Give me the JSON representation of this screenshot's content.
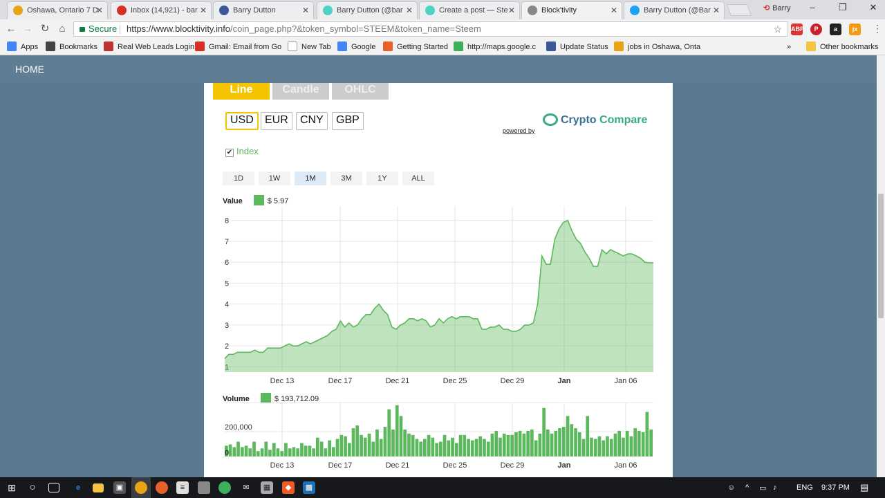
{
  "browser": {
    "tabs": [
      {
        "title": "Oshawa, Ontario 7 D",
        "icon": "weather-icon",
        "color": "#e8a317"
      },
      {
        "title": "Inbox (14,921) - bar",
        "icon": "gmail-icon",
        "color": "#d93025"
      },
      {
        "title": "Barry Dutton",
        "icon": "facebook-icon",
        "color": "#3b5998"
      },
      {
        "title": "Barry Dutton (@bar",
        "icon": "steemit-icon",
        "color": "#4fd1c5"
      },
      {
        "title": "Create a post — Ste",
        "icon": "steemit-icon",
        "color": "#4fd1c5"
      },
      {
        "title": "Block'tivity",
        "icon": "loading-icon",
        "color": "#888888"
      },
      {
        "title": "Barry Dutton (@Bar",
        "icon": "twitter-icon",
        "color": "#1da1f2"
      }
    ],
    "active_tab": 5,
    "profile_name": "Barry",
    "secure_label": "Secure",
    "url_host": "https://www.blocktivity.info",
    "url_path": "/coin_page.php?&token_symbol=STEEM&token_name=Steem",
    "bookmarks": [
      {
        "label": "Apps",
        "icon": "apps-icon"
      },
      {
        "label": "Bookmarks",
        "icon": "star-icon"
      },
      {
        "label": "Real Web Leads Login",
        "icon": "realweb-icon"
      },
      {
        "label": "Gmail: Email from Go",
        "icon": "gmail-icon"
      },
      {
        "label": "New Tab",
        "icon": "page-icon"
      },
      {
        "label": "Google",
        "icon": "google-icon"
      },
      {
        "label": "Getting Started",
        "icon": "firefox-icon"
      },
      {
        "label": "http://maps.google.c",
        "icon": "maps-icon"
      },
      {
        "label": "Update Status",
        "icon": "facebook-icon"
      },
      {
        "label": "jobs in Oshawa, Onta",
        "icon": "jobs-icon"
      }
    ],
    "bookmarks_more": "»",
    "other_bookmarks": "Other bookmarks"
  },
  "page": {
    "nav_home": "HOME",
    "chart_tabs": [
      {
        "label": "Line",
        "color": "#f5c400"
      },
      {
        "label": "Candle",
        "color": "#cccccc"
      },
      {
        "label": "OHLC",
        "color": "#cccccc"
      }
    ],
    "currencies": [
      "USD",
      "EUR",
      "CNY",
      "GBP"
    ],
    "selected_currency": "USD",
    "powered_by": "powered by",
    "logo_part1": "Crypto",
    "logo_part2": "Compare",
    "index_label": "Index",
    "index_checked": "✔",
    "ranges": [
      "1D",
      "1W",
      "1M",
      "3M",
      "1Y",
      "ALL"
    ],
    "selected_range": "1M",
    "value_label": "Value",
    "value_text": "$ 5.97",
    "volume_label": "Volume",
    "volume_text": "$ 193,712.09"
  },
  "chart_data": [
    {
      "type": "area",
      "title": "Value",
      "ylim": [
        1,
        8
      ],
      "yticks": [
        1,
        2,
        3,
        4,
        5,
        6,
        7,
        8
      ],
      "xlabels": [
        "Dec 13",
        "Dec 17",
        "Dec 21",
        "Dec 25",
        "Dec 29",
        "Jan",
        "Jan 06"
      ],
      "x": [
        0,
        1,
        2,
        3,
        4,
        5,
        6,
        7,
        8,
        9,
        10,
        11,
        12,
        13,
        14,
        15,
        16,
        17,
        18,
        19,
        20,
        21,
        22,
        23,
        24,
        25,
        26,
        27,
        28,
        29,
        30,
        31,
        32,
        33,
        34,
        35,
        36,
        37,
        38,
        39,
        40,
        41,
        42,
        43,
        44,
        45,
        46,
        47,
        48,
        49,
        50,
        51,
        52,
        53,
        54,
        55,
        56,
        57,
        58,
        59,
        60,
        61,
        62,
        63,
        64,
        65,
        66,
        67,
        68,
        69,
        70,
        71,
        72,
        73,
        74,
        75,
        76,
        77,
        78,
        79,
        80,
        81,
        82,
        83,
        84,
        85,
        86,
        87,
        88,
        89,
        90,
        91,
        92,
        93,
        94,
        95,
        96,
        97,
        98,
        99,
        100
      ],
      "values": [
        1.4,
        1.6,
        1.6,
        1.7,
        1.7,
        1.7,
        1.7,
        1.8,
        1.7,
        1.7,
        1.9,
        1.9,
        1.9,
        1.9,
        2.0,
        2.1,
        2.0,
        2.0,
        2.1,
        2.2,
        2.1,
        2.2,
        2.3,
        2.4,
        2.5,
        2.7,
        2.8,
        3.2,
        2.9,
        3.1,
        2.9,
        3.0,
        3.3,
        3.5,
        3.5,
        3.8,
        4.0,
        3.7,
        3.5,
        2.9,
        2.8,
        3.0,
        3.1,
        3.3,
        3.3,
        3.2,
        3.3,
        3.2,
        2.9,
        3.0,
        3.3,
        3.1,
        3.3,
        3.4,
        3.3,
        3.4,
        3.4,
        3.4,
        3.3,
        3.3,
        2.8,
        2.8,
        2.9,
        2.9,
        3.0,
        2.8,
        2.8,
        2.7,
        2.7,
        2.8,
        3.0,
        3.0,
        3.1,
        4.0,
        6.3,
        5.9,
        5.9,
        7.1,
        7.6,
        7.9,
        8.0,
        7.5,
        7.1,
        6.9,
        6.5,
        6.2,
        5.8,
        5.8,
        6.6,
        6.4,
        6.6,
        6.5,
        6.4,
        6.3,
        6.4,
        6.4,
        6.3,
        6.2,
        6.0,
        5.97,
        5.97
      ],
      "color": "#5cb85c"
    },
    {
      "type": "bar",
      "title": "Volume",
      "ylim": [
        0,
        400000
      ],
      "yticks": [
        0,
        200000
      ],
      "ytick_labels": [
        "0",
        "200,000"
      ],
      "xlabels": [
        "Dec 13",
        "Dec 17",
        "Dec 21",
        "Dec 25",
        "Dec 29",
        "Jan",
        "Jan 06"
      ],
      "values": [
        80000,
        90000,
        70000,
        110000,
        70000,
        80000,
        60000,
        110000,
        40000,
        60000,
        110000,
        50000,
        100000,
        60000,
        40000,
        100000,
        60000,
        70000,
        60000,
        100000,
        80000,
        80000,
        60000,
        140000,
        110000,
        60000,
        120000,
        70000,
        130000,
        160000,
        150000,
        100000,
        210000,
        230000,
        160000,
        140000,
        170000,
        110000,
        200000,
        130000,
        220000,
        350000,
        200000,
        380000,
        300000,
        200000,
        170000,
        160000,
        130000,
        110000,
        130000,
        160000,
        140000,
        100000,
        110000,
        160000,
        120000,
        140000,
        100000,
        160000,
        160000,
        130000,
        120000,
        130000,
        150000,
        130000,
        110000,
        170000,
        190000,
        140000,
        170000,
        160000,
        160000,
        180000,
        190000,
        170000,
        190000,
        200000,
        120000,
        170000,
        360000,
        200000,
        170000,
        190000,
        210000,
        220000,
        300000,
        240000,
        210000,
        180000,
        130000,
        300000,
        140000,
        130000,
        150000,
        120000,
        150000,
        130000,
        170000,
        190000,
        140000,
        190000,
        150000,
        210000,
        190000,
        180000,
        330000,
        200000
      ],
      "color": "#5cb85c"
    }
  ],
  "taskbar": {
    "time": "9:37 PM",
    "lang": "ENG"
  }
}
